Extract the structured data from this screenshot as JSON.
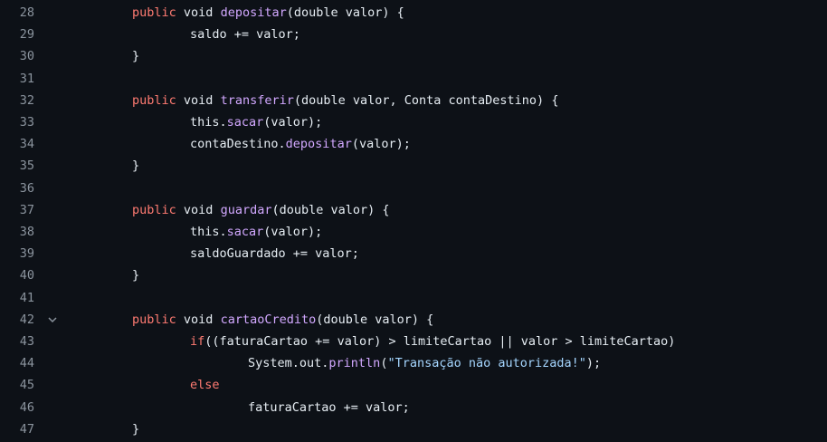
{
  "lines": [
    {
      "num": "28",
      "indent": 1,
      "tokens": [
        [
          "k",
          "public"
        ],
        [
          "p",
          " void "
        ],
        [
          "f",
          "depositar"
        ],
        [
          "p",
          "(double valor) {"
        ]
      ]
    },
    {
      "num": "29",
      "indent": 2,
      "tokens": [
        [
          "p",
          "saldo += valor;"
        ]
      ]
    },
    {
      "num": "30",
      "indent": 1,
      "tokens": [
        [
          "p",
          "}"
        ]
      ]
    },
    {
      "num": "31",
      "indent": 0,
      "tokens": []
    },
    {
      "num": "32",
      "indent": 1,
      "tokens": [
        [
          "k",
          "public"
        ],
        [
          "p",
          " void "
        ],
        [
          "f",
          "transferir"
        ],
        [
          "p",
          "(double valor, Conta contaDestino) {"
        ]
      ]
    },
    {
      "num": "33",
      "indent": 2,
      "tokens": [
        [
          "p",
          "this."
        ],
        [
          "f",
          "sacar"
        ],
        [
          "p",
          "(valor);"
        ]
      ]
    },
    {
      "num": "34",
      "indent": 2,
      "tokens": [
        [
          "p",
          "contaDestino."
        ],
        [
          "f",
          "depositar"
        ],
        [
          "p",
          "(valor);"
        ]
      ]
    },
    {
      "num": "35",
      "indent": 1,
      "tokens": [
        [
          "p",
          "}"
        ]
      ]
    },
    {
      "num": "36",
      "indent": 0,
      "tokens": []
    },
    {
      "num": "37",
      "indent": 1,
      "tokens": [
        [
          "k",
          "public"
        ],
        [
          "p",
          " void "
        ],
        [
          "f",
          "guardar"
        ],
        [
          "p",
          "(double valor) {"
        ]
      ]
    },
    {
      "num": "38",
      "indent": 2,
      "tokens": [
        [
          "p",
          "this."
        ],
        [
          "f",
          "sacar"
        ],
        [
          "p",
          "(valor);"
        ]
      ]
    },
    {
      "num": "39",
      "indent": 2,
      "tokens": [
        [
          "p",
          "saldoGuardado += valor;"
        ]
      ]
    },
    {
      "num": "40",
      "indent": 1,
      "tokens": [
        [
          "p",
          "}"
        ]
      ]
    },
    {
      "num": "41",
      "indent": 0,
      "tokens": []
    },
    {
      "num": "42",
      "indent": 1,
      "fold": true,
      "tokens": [
        [
          "k",
          "public"
        ],
        [
          "p",
          " void "
        ],
        [
          "f",
          "cartaoCredito"
        ],
        [
          "p",
          "(double valor) {"
        ]
      ]
    },
    {
      "num": "43",
      "indent": 2,
      "tokens": [
        [
          "k",
          "if"
        ],
        [
          "p",
          "((faturaCartao += valor) > limiteCartao || valor > limiteCartao)"
        ]
      ]
    },
    {
      "num": "44",
      "indent": 3,
      "tokens": [
        [
          "p",
          "System.out."
        ],
        [
          "f",
          "println"
        ],
        [
          "p",
          "("
        ],
        [
          "s",
          "\"Transação não autorizada!\""
        ],
        [
          "p",
          ");"
        ]
      ]
    },
    {
      "num": "45",
      "indent": 2,
      "tokens": [
        [
          "k",
          "else"
        ]
      ]
    },
    {
      "num": "46",
      "indent": 3,
      "tokens": [
        [
          "p",
          "faturaCartao += valor;"
        ]
      ]
    },
    {
      "num": "47",
      "indent": 1,
      "tokens": [
        [
          "p",
          "}"
        ]
      ]
    }
  ],
  "colors": {
    "background": "#0d1117",
    "line_number": "#8b949e",
    "keyword": "#ff7b72",
    "function": "#d2a8ff",
    "string": "#a5d6ff",
    "plain": "#e6edf3"
  },
  "icons": {
    "fold": "chevron-down-icon"
  }
}
